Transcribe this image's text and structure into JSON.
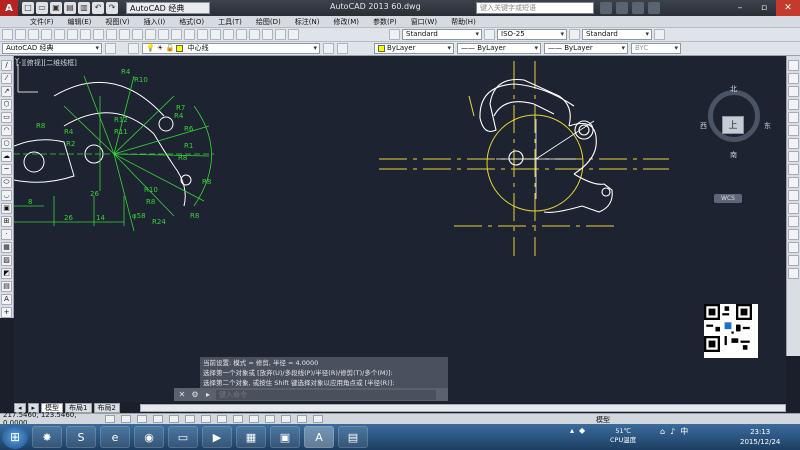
{
  "app": {
    "title": "AutoCAD 2013    60.dwg",
    "search_placeholder": "键入关键字或短语",
    "workspace": "AutoCAD 经典"
  },
  "menu": [
    "文件(F)",
    "编辑(E)",
    "视图(V)",
    "插入(I)",
    "格式(O)",
    "工具(T)",
    "绘图(D)",
    "标注(N)",
    "修改(M)",
    "参数(P)",
    "窗口(W)",
    "帮助(H)"
  ],
  "toolbar": {
    "text_style": "Standard",
    "dim_style": "ISO-25",
    "table_style": "Standard",
    "workspace_dropdown": "AutoCAD 经典",
    "layer": "中心线",
    "color": "ByLayer",
    "linetype": "ByLayer",
    "lineweight": "ByLayer",
    "plot_style": "BYC"
  },
  "viewport": {
    "label": "[-][俯视][二维线框]"
  },
  "viewcube": {
    "top": "上",
    "north": "北",
    "south": "南",
    "west": "西",
    "east": "东",
    "wcs": "WCS"
  },
  "dimensions": [
    "R4",
    "R10",
    "R7",
    "R4",
    "R12",
    "R11",
    "R8",
    "R4",
    "R2",
    "R6",
    "R1",
    "R8",
    "R8",
    "R10",
    "R8",
    "R24",
    "φ58",
    "R8",
    "26",
    "14",
    "8",
    "26"
  ],
  "command": {
    "history": [
      "当前设置: 模式 = 修剪, 半径 = 4.0000",
      "选择第一个对象或 [放弃(U)/多段线(P)/半径(R)/修剪(T)/多个(M)]:",
      "选择第二个对象, 或按住 Shift 键选择对象以应用角点或 [半径(R)]:"
    ],
    "placeholder": "键入命令"
  },
  "tabs": [
    "模型",
    "布局1",
    "布局2"
  ],
  "status": {
    "coords": "217.5460, 123.5460, 0.0000",
    "model": "模型"
  },
  "taskbar": {
    "weather_temp": "51℃",
    "weather_label": "CPU温度",
    "time": "23:13",
    "date": "2015/12/24"
  }
}
